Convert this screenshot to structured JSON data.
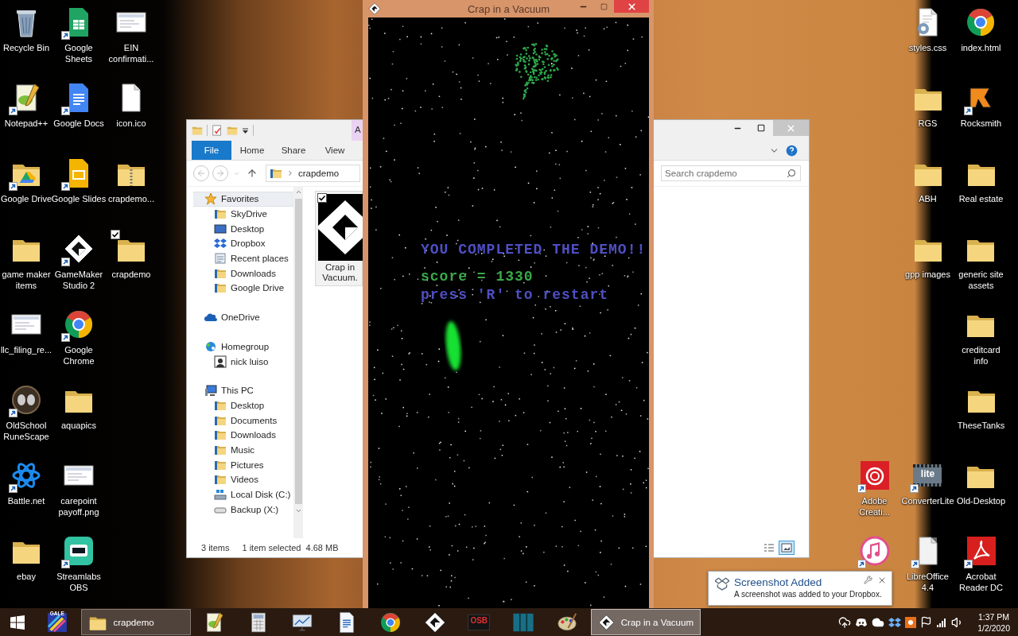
{
  "desktop_left": [
    {
      "label": "Recycle Bin",
      "kind": "recycle",
      "shortcut": false,
      "selected": false
    },
    {
      "label": "Notepad++",
      "kind": "notepad",
      "shortcut": true,
      "selected": false
    },
    {
      "label": "Google Drive",
      "kind": "drive",
      "shortcut": true,
      "selected": false
    },
    {
      "label": "game maker\nitems",
      "kind": "folder",
      "shortcut": false,
      "selected": false
    },
    {
      "label": "llc_filing_re...",
      "kind": "image",
      "shortcut": false,
      "selected": false
    },
    {
      "label": "OldSchool\nRuneScape",
      "kind": "runescape",
      "shortcut": true,
      "selected": false
    },
    {
      "label": "Battle.net",
      "kind": "battlenet",
      "shortcut": true,
      "selected": false
    },
    {
      "label": "ebay",
      "kind": "folder",
      "shortcut": false,
      "selected": false
    },
    {
      "label": "Google\nSheets",
      "kind": "sheets",
      "shortcut": true,
      "selected": false
    },
    {
      "label": "Google Docs",
      "kind": "docs",
      "shortcut": true,
      "selected": false
    },
    {
      "label": "Google Slides",
      "kind": "slides",
      "shortcut": true,
      "selected": false
    },
    {
      "label": "GameMaker\nStudio 2",
      "kind": "gamemaker",
      "shortcut": true,
      "selected": false
    },
    {
      "label": "Google\nChrome",
      "kind": "chrome",
      "shortcut": true,
      "selected": false
    },
    {
      "label": "aquapics",
      "kind": "folder",
      "shortcut": false,
      "selected": false
    },
    {
      "label": "carepoint\npayoff.png",
      "kind": "image",
      "shortcut": false,
      "selected": false
    },
    {
      "label": "Streamlabs\nOBS",
      "kind": "streamlabs",
      "shortcut": true,
      "selected": false
    },
    {
      "label": "EIN\nconfirmati...",
      "kind": "image",
      "shortcut": false,
      "selected": false
    },
    {
      "label": "icon.ico",
      "kind": "file",
      "shortcut": false,
      "selected": false
    },
    {
      "label": "crapdemo...",
      "kind": "zip",
      "shortcut": false,
      "selected": false
    },
    {
      "label": "crapdemo",
      "kind": "folder",
      "shortcut": false,
      "selected": true
    }
  ],
  "desktop_right": [
    {
      "label": "Adobe\nCreati...",
      "kind": "adobe",
      "shortcut": true,
      "selected": false
    },
    {
      "kind": "itunes",
      "shortcut": true,
      "selected": false
    },
    {
      "label": "styles.css",
      "kind": "css",
      "shortcut": false,
      "selected": false
    },
    {
      "label": "RGS",
      "kind": "folder",
      "shortcut": false,
      "selected": false
    },
    {
      "label": "ABH",
      "kind": "folder",
      "shortcut": false,
      "selected": false
    },
    {
      "label": "gpp images",
      "kind": "folder",
      "shortcut": false,
      "selected": false
    },
    {
      "label": "ConverterLite",
      "kind": "converter",
      "icon_text": "lite",
      "shortcut": true,
      "selected": false
    },
    {
      "label": "LibreOffice\n4.4",
      "kind": "libreoffice",
      "shortcut": true,
      "selected": false
    },
    {
      "label": "index.html",
      "kind": "chrome",
      "shortcut": false,
      "selected": false
    },
    {
      "label": "Rocksmith",
      "kind": "rocksmith",
      "shortcut": true,
      "selected": false
    },
    {
      "label": "Real estate",
      "kind": "folder",
      "shortcut": false,
      "selected": false
    },
    {
      "label": "generic site\nassets",
      "kind": "folder",
      "shortcut": false,
      "selected": false
    },
    {
      "label": "creditcard\ninfo",
      "kind": "folder",
      "shortcut": false,
      "selected": false
    },
    {
      "label": "TheseTanks",
      "kind": "folder",
      "shortcut": false,
      "selected": false
    },
    {
      "label": "Old-Desktop",
      "kind": "folder",
      "shortcut": false,
      "selected": false
    },
    {
      "label": "Acrobat\nReader DC",
      "kind": "acrobat",
      "shortcut": true,
      "selected": false
    }
  ],
  "explorer": {
    "contextual_tab": "A",
    "file_tab": "File",
    "ribbon_tabs": [
      "Home",
      "Share",
      "View"
    ],
    "address": "crapdemo",
    "search": {
      "placeholder": "Search crapdemo"
    },
    "nav": [
      {
        "label": "Favorites",
        "kind": "star",
        "selected": true,
        "children": [
          {
            "label": "SkyDrive",
            "kind": "folder",
            "selected": false
          },
          {
            "label": "Desktop",
            "kind": "desktop",
            "selected": false
          },
          {
            "label": "Dropbox",
            "kind": "dropbox",
            "selected": false
          },
          {
            "label": "Recent places",
            "kind": "recent",
            "selected": false
          },
          {
            "label": "Downloads",
            "kind": "folder",
            "selected": false
          },
          {
            "label": "Google Drive",
            "kind": "folder",
            "selected": false
          }
        ]
      },
      {
        "label": "OneDrive",
        "kind": "cloud",
        "selected": false
      },
      {
        "label": "Homegroup",
        "kind": "homegroup",
        "selected": false,
        "children": [
          {
            "label": "nick luiso",
            "kind": "user",
            "selected": false
          }
        ]
      },
      {
        "label": "This PC",
        "kind": "pc",
        "selected": false,
        "children": [
          {
            "label": "Desktop",
            "kind": "folder",
            "selected": false
          },
          {
            "label": "Documents",
            "kind": "folder",
            "selected": false
          },
          {
            "label": "Downloads",
            "kind": "folder",
            "selected": false
          },
          {
            "label": "Music",
            "kind": "folder",
            "selected": false
          },
          {
            "label": "Pictures",
            "kind": "folder",
            "selected": false
          },
          {
            "label": "Videos",
            "kind": "folder",
            "selected": false
          },
          {
            "label": "Local Disk (C:)",
            "kind": "disk",
            "selected": false
          },
          {
            "label": "Backup (X:)",
            "kind": "usb",
            "selected": false
          }
        ]
      }
    ],
    "files": [
      {
        "name": "Crap in\nVacuum.",
        "selected": true,
        "checked": true
      }
    ],
    "status": {
      "count": "3 items",
      "selection": "1 item selected  4.68 MB"
    },
    "views": [
      {
        "kind": "details",
        "selected": false
      },
      {
        "kind": "large",
        "selected": true
      }
    ]
  },
  "game": {
    "title": "Crap in a Vacuum",
    "lines": [
      {
        "kind": "headline",
        "text": "YOU COMPLETED THE DEMO!!"
      },
      {
        "kind": "score",
        "text": "score = 1330"
      },
      {
        "kind": "hint",
        "text": "press 'R' to restart"
      }
    ]
  },
  "toast": {
    "title": "Screenshot Added",
    "message": "A screenshot was added to your Dropbox."
  },
  "taskbar": {
    "items": [
      {
        "kind": "gale",
        "icon_text": "GALE",
        "open": false,
        "selected": false
      },
      {
        "kind": "folder",
        "label": "crapdemo",
        "open": true,
        "selected": false
      },
      {
        "kind": "notepad",
        "open": false,
        "selected": false
      },
      {
        "kind": "calculator",
        "open": false,
        "selected": false
      },
      {
        "kind": "monitor",
        "open": false,
        "selected": false
      },
      {
        "kind": "page",
        "open": false,
        "selected": false
      },
      {
        "kind": "chrome",
        "open": false,
        "selected": false
      },
      {
        "kind": "gamemaker",
        "open": false,
        "selected": false
      },
      {
        "kind": "osb",
        "icon_text": "OSB",
        "open": false,
        "selected": false
      },
      {
        "kind": "panels",
        "open": false,
        "selected": false
      },
      {
        "kind": "palette",
        "open": false,
        "selected": false
      },
      {
        "kind": "gamemaker",
        "label": "Crap in a Vacuum",
        "open": true,
        "selected": true
      }
    ],
    "tray": [
      {
        "kind": "upload"
      },
      {
        "kind": "discord"
      },
      {
        "kind": "cloud"
      },
      {
        "kind": "dropbox"
      },
      {
        "kind": "orange"
      },
      {
        "kind": "flag"
      },
      {
        "kind": "signal"
      },
      {
        "kind": "volume"
      }
    ],
    "time": "1:37 PM",
    "date": "1/2/2020"
  }
}
